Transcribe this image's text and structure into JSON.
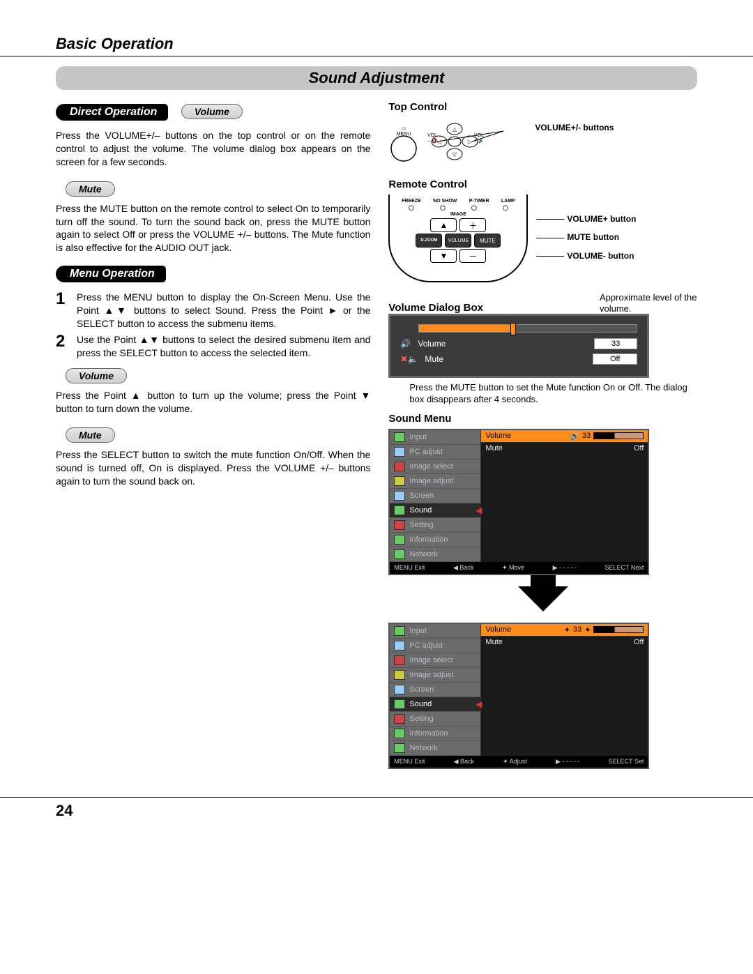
{
  "chapter": "Basic Operation",
  "section": "Sound Adjustment",
  "pills": {
    "direct": "Direct Operation",
    "menu": "Menu Operation",
    "volume": "Volume",
    "mute": "Mute"
  },
  "paragraphs": {
    "volume1": "Press the VOLUME+/– buttons on the top control or on the remote control to adjust the volume. The volume dialog box appears on the screen for a few seconds.",
    "mute1": "Press the MUTE button on the remote control to select On to temporarily turn off the sound. To turn the sound back on, press the MUTE button again to select Off or press the VOLUME +/– buttons. The Mute function is also effective for the AUDIO OUT jack.",
    "step1": "Press the MENU button to display the On-Screen Menu. Use the Point ▲▼ buttons to select Sound. Press the Point ► or the SELECT button to access the submenu items.",
    "step2": "Use the Point ▲▼ buttons to select the desired submenu item and press the SELECT button to access the selected item.",
    "volume2": "Press the Point ▲ button to turn up the volume; press the Point ▼ button to turn down the volume.",
    "mute2": "Press the SELECT button to switch the mute function On/Off. When the sound is turned off, On is displayed. Press the VOLUME +/– buttons again to turn the sound back on."
  },
  "right": {
    "top_control": "Top Control",
    "remote_control": "Remote Control",
    "volume_dialog": "Volume Dialog Box",
    "sound_menu": "Sound Menu",
    "vol_buttons_label": "VOLUME+/- buttons",
    "tc_menu": "MENU",
    "tc_volminus": "VOL\n–",
    "tc_volplus": "VOL\n+",
    "remote": {
      "row_labels": [
        "FREEZE",
        "NO SHOW",
        "P-TIMER",
        "LAMP"
      ],
      "image": "IMAGE",
      "dzoom": "D.ZOOM",
      "volume": "VOLUME",
      "mute": "MUTE"
    },
    "remote_labels": {
      "volp": "VOLUME+ button",
      "mute": "MUTE button",
      "volm": "VOLUME- button"
    },
    "approx": "Approximate level of the volume.",
    "vd": {
      "volume_label": "Volume",
      "volume_value": "33",
      "mute_label": "Mute",
      "mute_value": "Off"
    },
    "vd_caption": "Press the MUTE button to set the Mute function On or Off. The dialog box disappears after 4 seconds.",
    "menu_items": [
      "Input",
      "PC adjust",
      "Image select",
      "Image adjust",
      "Screen",
      "Sound",
      "Setting",
      "Information",
      "Network"
    ],
    "osd": {
      "volume": "Volume",
      "mute": "Mute",
      "val": "33",
      "off": "Off"
    },
    "footer1": {
      "exit": "MENU Exit",
      "back": "◀ Back",
      "move": "✦ Move",
      "blank": "▶ - - - - -",
      "next": "SELECT Next"
    },
    "footer2": {
      "exit": "MENU Exit",
      "back": "◀ Back",
      "move": "✦ Adjust",
      "blank": "▶ - - - - -",
      "next": "SELECT Set"
    }
  },
  "page_number": "24"
}
